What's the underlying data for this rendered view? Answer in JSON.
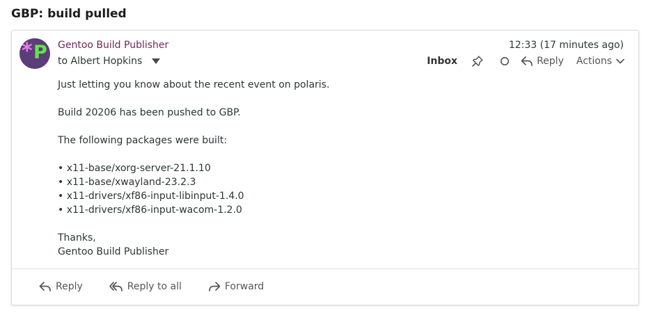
{
  "subject": "GBP: build pulled",
  "message": {
    "sender_name": "Gentoo Build Publisher",
    "to_line": "to Albert Hopkins",
    "timestamp": "12:33 (17 minutes ago)",
    "folder": "Inbox",
    "reply_label": "Reply",
    "actions_label": "Actions",
    "avatar": {
      "colors": {
        "bg": "#5b3d7a",
        "star": "#e87ce8",
        "p": "#61e649"
      }
    },
    "body": {
      "intro": "Just letting you know about the recent event on polaris.",
      "build_line": "Build 20206 has been pushed to GBP.",
      "packages_heading": "The following packages were built:",
      "packages": [
        "x11-base/xorg-server-21.1.10",
        "x11-base/xwayland-23.2.3",
        "x11-drivers/xf86-input-libinput-1.4.0",
        "x11-drivers/xf86-input-wacom-1.2.0"
      ],
      "thanks": "Thanks,",
      "signature": "Gentoo Build Publisher"
    }
  },
  "footer": {
    "reply_label": "Reply",
    "reply_all_label": "Reply to all",
    "forward_label": "Forward"
  },
  "icons": {
    "pin": "pin-icon",
    "unread": "circle-icon",
    "reply": "reply-arrow-icon",
    "reply_all": "reply-all-arrow-icon",
    "forward": "forward-arrow-icon",
    "dropdown": "chevron-down-icon"
  },
  "colors": {
    "sender": "#6b2a55",
    "text": "#2e3436"
  }
}
